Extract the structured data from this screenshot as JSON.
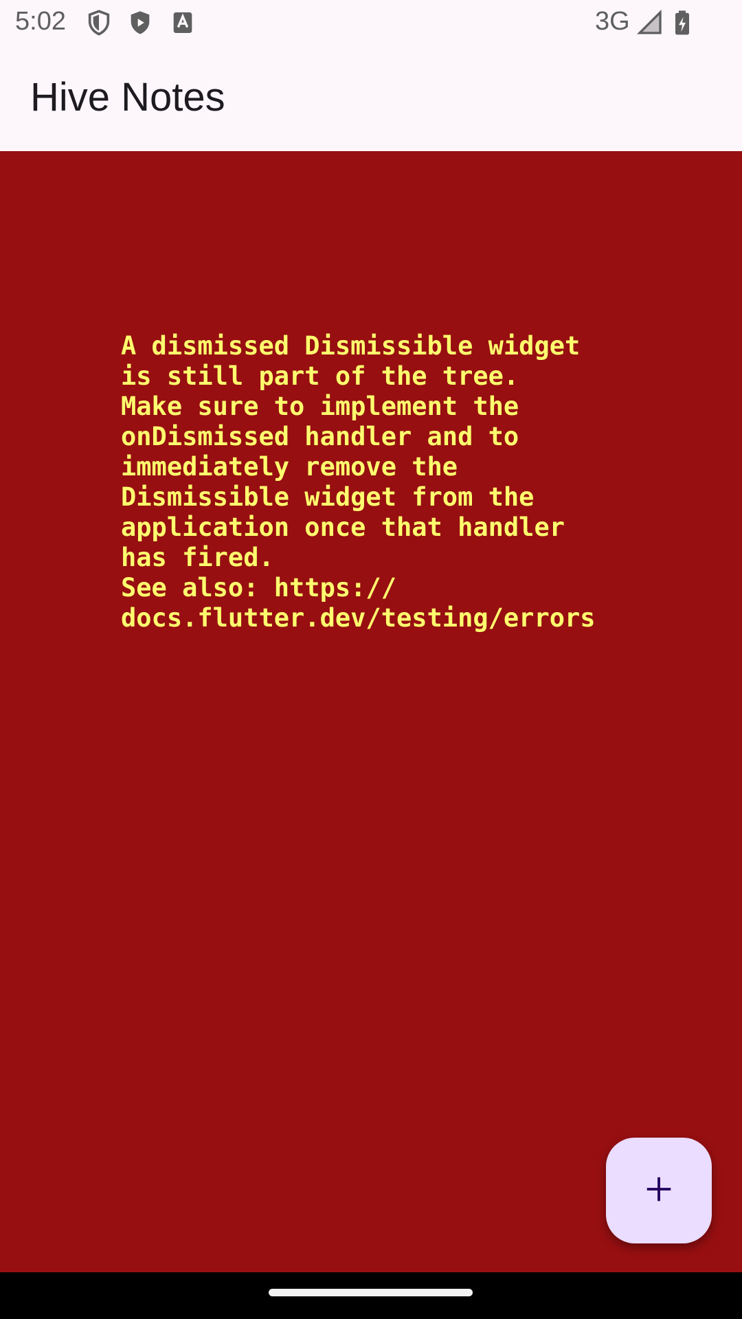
{
  "status_bar": {
    "time": "5:02",
    "network": "3G",
    "icons": [
      "shield-outline-icon",
      "shield-play-icon",
      "text-a-icon",
      "signal-icon",
      "battery-charging-icon"
    ]
  },
  "app_bar": {
    "title": "Hive Notes"
  },
  "error": {
    "message": "A dismissed Dismissible widget\nis still part of the tree.\nMake sure to implement the\nonDismissed handler and to\nimmediately remove the\nDismissible widget from the\napplication once that handler\nhas fired.\nSee also: https://\ndocs.flutter.dev/testing/errors",
    "background_color": "#970f11",
    "text_color": "#fdfd6e"
  },
  "fab": {
    "icon": "plus-icon",
    "background_color": "#eaddff"
  },
  "colors": {
    "surface": "#fdf7fc",
    "on_surface": "#1d1b20"
  }
}
